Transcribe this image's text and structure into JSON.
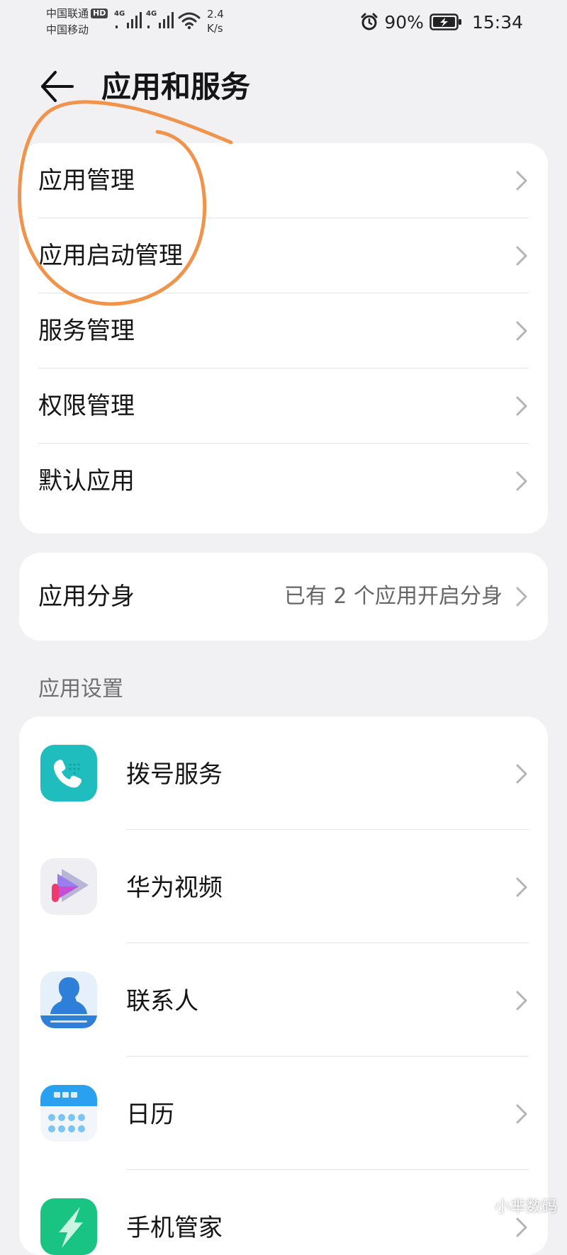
{
  "status_bar": {
    "carrier_1": "中国联通",
    "carrier_1_badge": "HD",
    "carrier_2": "中国移动",
    "signal_1_label": "4G",
    "signal_2_label": "4G",
    "net_speed_value": "2.4",
    "net_speed_unit": "K/s",
    "battery_percent": "90%",
    "time": "15:34",
    "icons": [
      "signal-icon",
      "signal-icon",
      "wifi-icon",
      "alarm-icon",
      "battery-charging-icon"
    ]
  },
  "header": {
    "back_icon": "arrow-left-icon",
    "title": "应用和服务"
  },
  "main_menu": {
    "items": [
      {
        "label": "应用管理"
      },
      {
        "label": "应用启动管理"
      },
      {
        "label": "服务管理"
      },
      {
        "label": "权限管理"
      },
      {
        "label": "默认应用"
      }
    ]
  },
  "app_twin": {
    "label": "应用分身",
    "value": "已有 2 个应用开启分身"
  },
  "app_settings": {
    "section_title": "应用设置",
    "items": [
      {
        "label": "拨号服务",
        "icon": "phone-dialer-icon"
      },
      {
        "label": "华为视频",
        "icon": "huawei-video-icon"
      },
      {
        "label": "联系人",
        "icon": "contacts-icon"
      },
      {
        "label": "日历",
        "icon": "calendar-icon"
      },
      {
        "label": "手机管家",
        "icon": "phone-manager-icon"
      }
    ]
  },
  "watermark": "小芈数码",
  "colors": {
    "background": "#f1f1f4",
    "card": "#ffffff",
    "annotation_stroke": "#f0944d",
    "dialer_icon": "#1fbdbd",
    "contacts_icon": "#2d7fd8",
    "calendar_icon": "#2aa0f0",
    "manager_icon": "#19c483"
  }
}
